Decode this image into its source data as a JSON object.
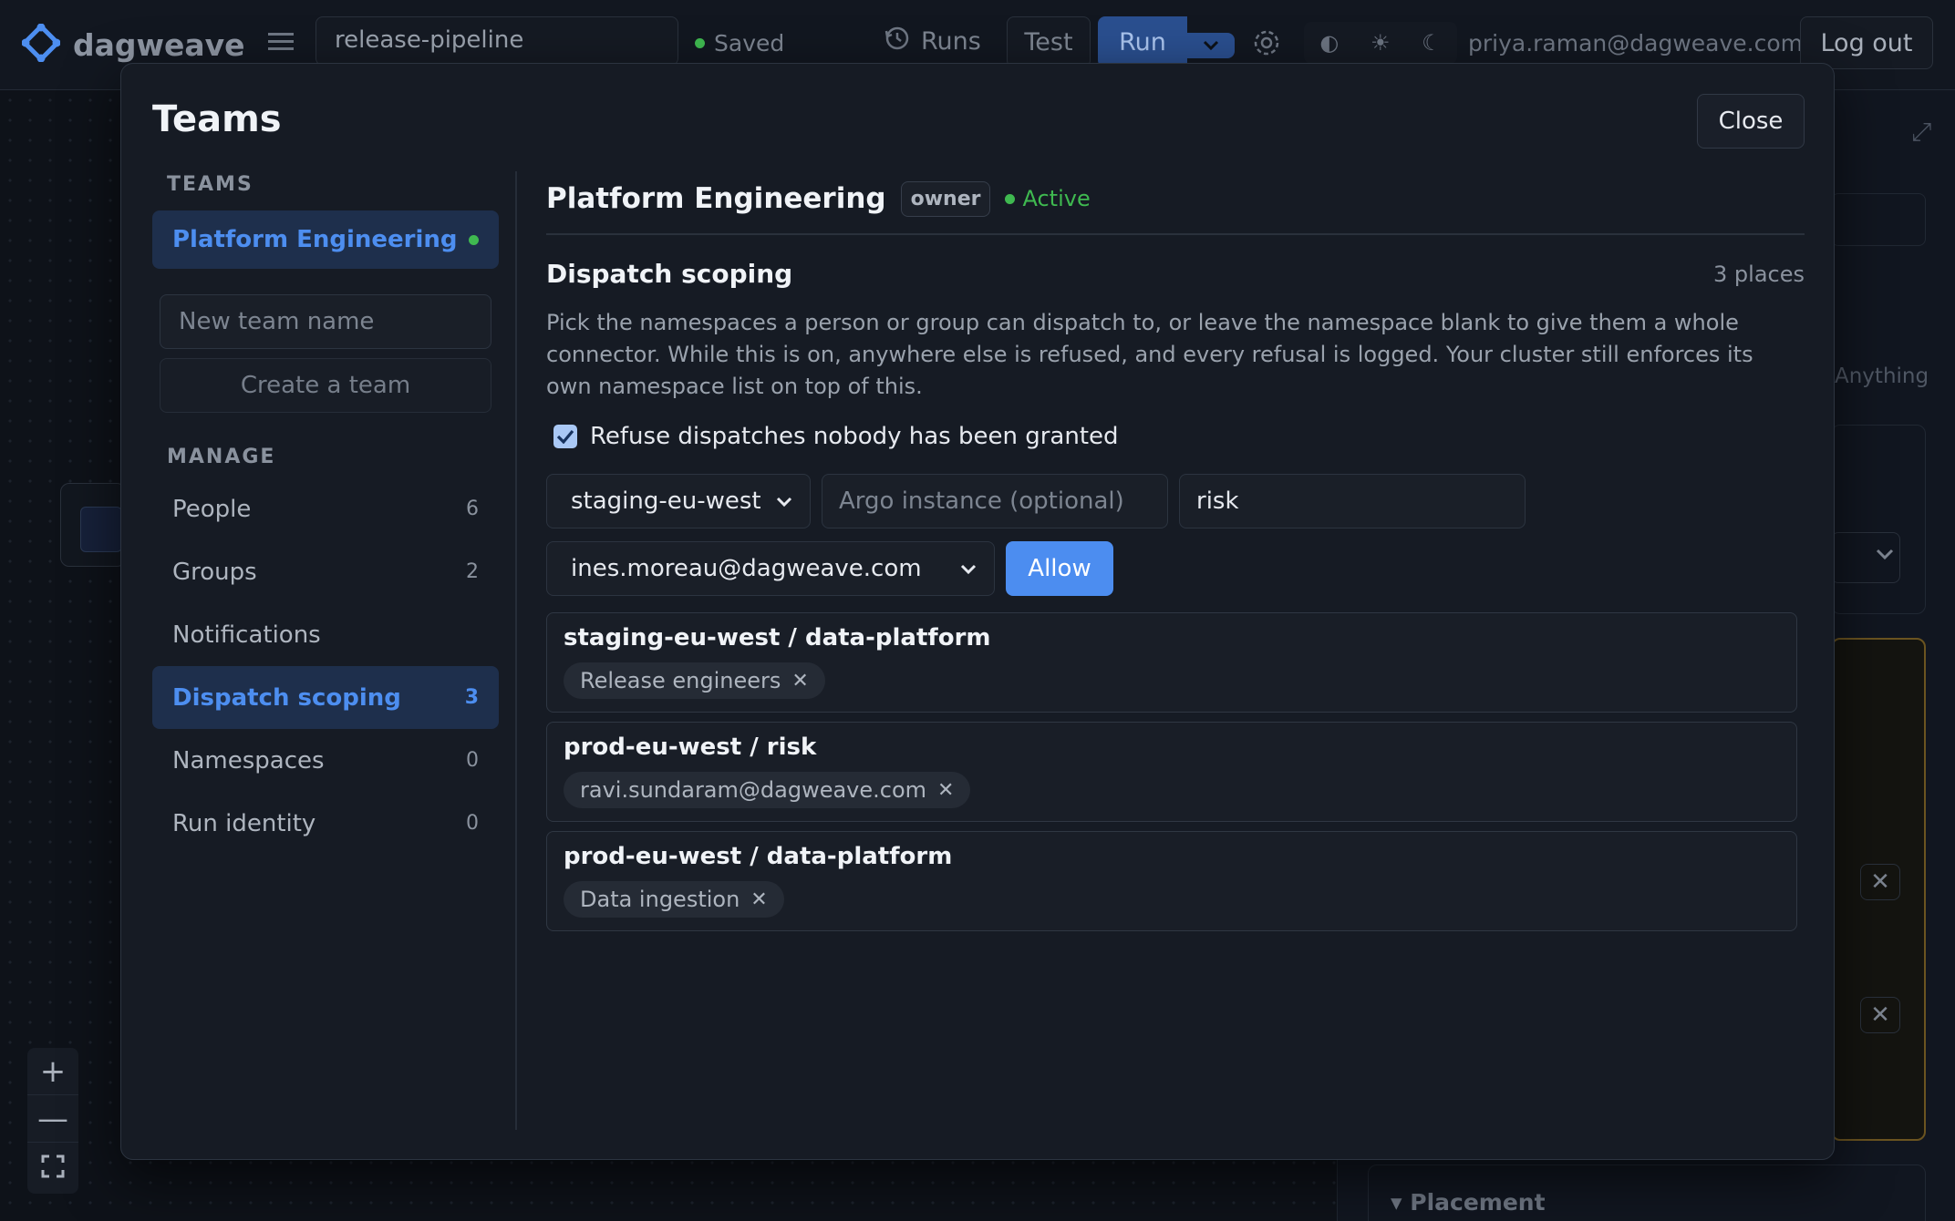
{
  "header": {
    "brand": "dagweave",
    "pipeline_name": "release-pipeline",
    "saved_status": "Saved",
    "runs_label": "Runs",
    "test_label": "Test",
    "run_label": "Run",
    "user_email": "priya.raman@dagweave.com",
    "logout_label": "Log out"
  },
  "background": {
    "anything_label": "Anything",
    "placement_label": "Placement"
  },
  "modal": {
    "title": "Teams",
    "close_label": "Close",
    "sidebar": {
      "teams_heading": "TEAMS",
      "team_name": "Platform Engineering",
      "new_team_placeholder": "New team name",
      "create_team_label": "Create a team",
      "manage_heading": "MANAGE",
      "items": [
        {
          "label": "People",
          "count": "6"
        },
        {
          "label": "Groups",
          "count": "2"
        },
        {
          "label": "Notifications",
          "count": ""
        },
        {
          "label": "Dispatch scoping",
          "count": "3"
        },
        {
          "label": "Namespaces",
          "count": "0"
        },
        {
          "label": "Run identity",
          "count": "0"
        }
      ]
    },
    "main": {
      "team_name": "Platform Engineering",
      "role_badge": "owner",
      "status": "Active",
      "section_title": "Dispatch scoping",
      "section_count": "3 places",
      "description": "Pick the namespaces a person or group can dispatch to, or leave the namespace blank to give them a whole connector. While this is on, anywhere else is refused, and every refusal is logged. Your cluster still enforces its own namespace list on top of this.",
      "refuse_checkbox_label": "Refuse dispatches nobody has been granted",
      "refuse_checked": true,
      "connector_select": "staging-eu-west",
      "argo_placeholder": "Argo instance (optional)",
      "namespace_value": "risk",
      "grantee_select": "ines.moreau@dagweave.com",
      "allow_label": "Allow",
      "grants": [
        {
          "target": "staging-eu-west / data-platform",
          "grantee": "Release engineers"
        },
        {
          "target": "prod-eu-west / risk",
          "grantee": "ravi.sundaram@dagweave.com"
        },
        {
          "target": "prod-eu-west / data-platform",
          "grantee": "Data ingestion"
        }
      ]
    }
  },
  "colors": {
    "accent": "#4c8df0",
    "active_green": "#3fb950",
    "surface": "#161b24"
  }
}
